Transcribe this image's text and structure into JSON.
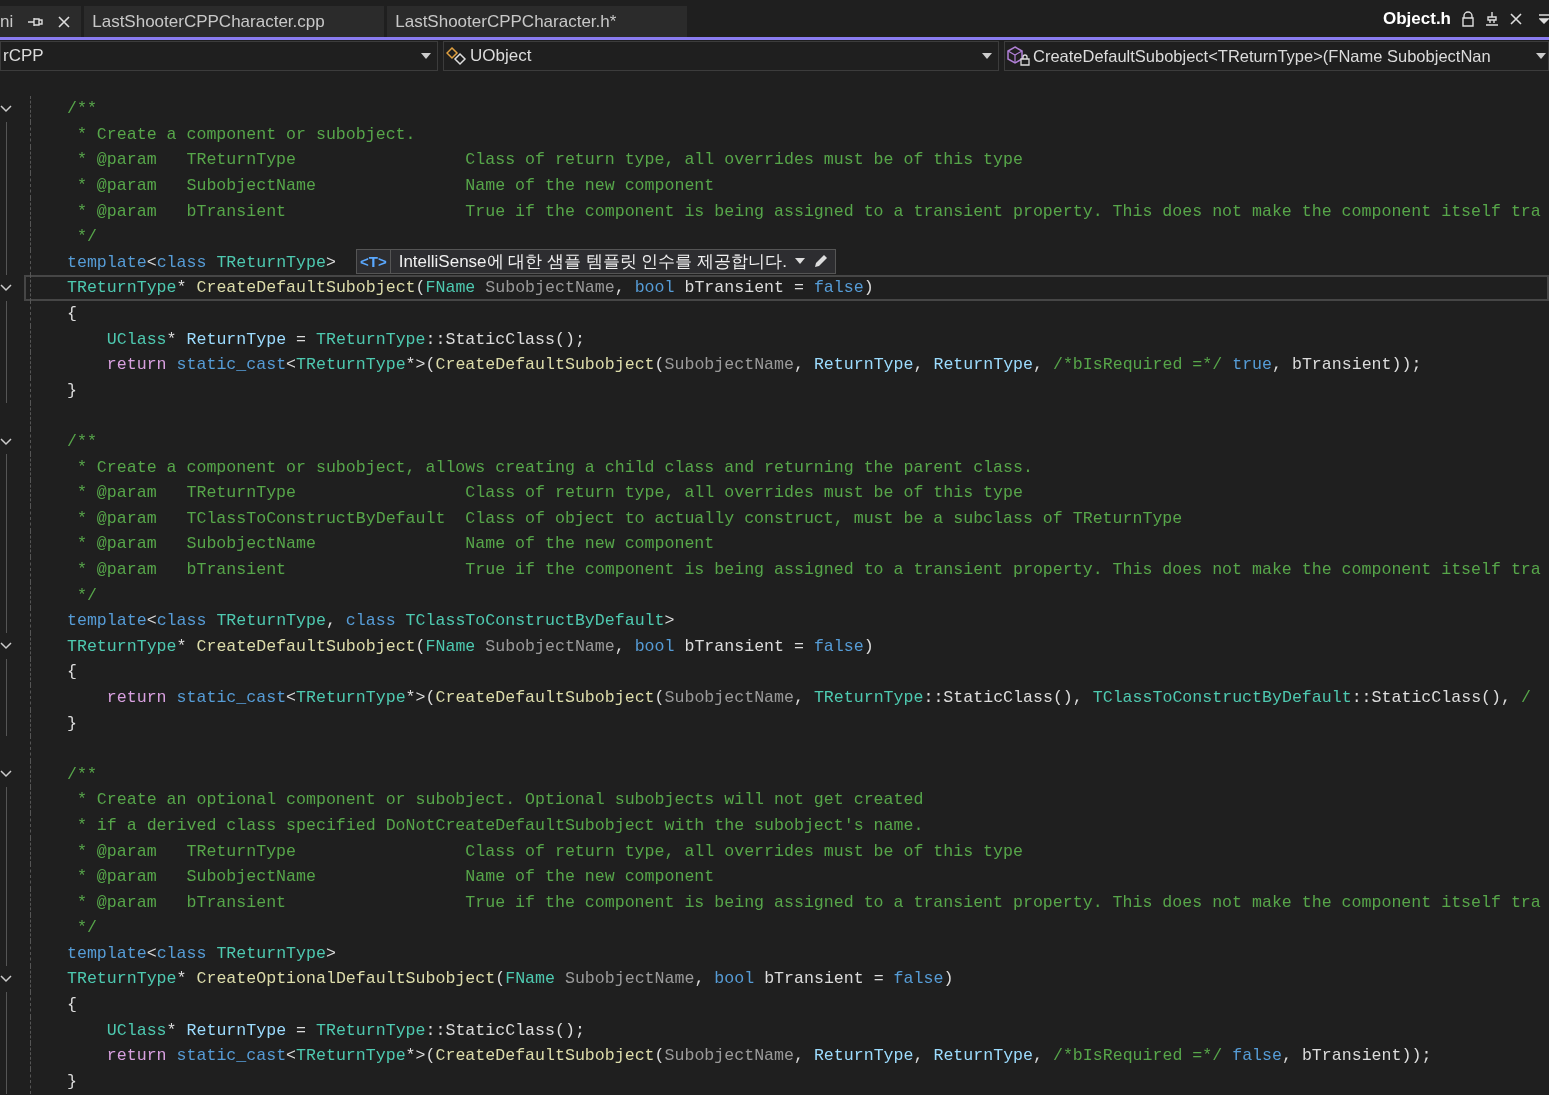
{
  "tabs": [
    {
      "label": "ni",
      "selected": false,
      "pinned": true,
      "closable": true
    },
    {
      "label": "LastShooterCPPCharacter.cpp",
      "selected": false,
      "closable": false
    },
    {
      "label": "LastShooterCPPCharacter.h*",
      "selected": false,
      "closable": false
    }
  ],
  "docked_tabs": [
    {
      "label": "Object.h",
      "selected": true,
      "read_only": true,
      "pinned": false,
      "closable": true
    }
  ],
  "navigation": [
    {
      "label": "rCPP",
      "kind": "plain"
    },
    {
      "label": "UObject",
      "kind": "class"
    },
    {
      "label": "CreateDefaultSubobject<TReturnType>(FName SubobjectNan",
      "kind": "method"
    }
  ],
  "lines": [
    {
      "fold": true,
      "tokens": [
        {
          "kind": "c",
          "text": "/**"
        }
      ]
    },
    {
      "tokens": [
        {
          "kind": "c",
          "text": " * Create a component or subobject."
        }
      ]
    },
    {
      "tokens": [
        {
          "kind": "c",
          "text": " * @param   TReturnType                 Class of return type, all overrides must be of this type"
        }
      ]
    },
    {
      "tokens": [
        {
          "kind": "c",
          "text": " * @param   SubobjectName               Name of the new component"
        }
      ]
    },
    {
      "tokens": [
        {
          "kind": "c",
          "text": " * @param   bTransient                  True if the component is being assigned to a transient property. This does not make the component itself tra"
        }
      ]
    },
    {
      "tokens": [
        {
          "kind": "c",
          "text": " */"
        }
      ]
    },
    {
      "tokens": [
        {
          "kind": "kw",
          "text": "template"
        },
        {
          "kind": "p",
          "text": "<"
        },
        {
          "kind": "kw",
          "text": "class"
        },
        {
          "kind": "ty",
          "text": " TReturnType"
        },
        {
          "kind": "p",
          "text": ">"
        }
      ],
      "hint": {
        "tag": "<T>",
        "text": "IntelliSense에 대한 샘플 템플릿 인수를 제공합니다."
      }
    },
    {
      "fold": true,
      "current": true,
      "tokens": [
        {
          "kind": "ty",
          "text": "TReturnType"
        },
        {
          "kind": "p",
          "text": "*"
        },
        {
          "kind": "fn",
          "text": " CreateDefaultSubobject"
        },
        {
          "kind": "p",
          "text": "("
        },
        {
          "kind": "ty",
          "text": "FName"
        },
        {
          "kind": "prm",
          "text": " SubobjectName"
        },
        {
          "kind": "p",
          "text": ","
        },
        {
          "kind": "kw",
          "text": " bool"
        },
        {
          "kind": "p",
          "text": " bTransient ="
        },
        {
          "kind": "kw",
          "text": " false"
        },
        {
          "kind": "p",
          "text": ")"
        }
      ]
    },
    {
      "tokens": [
        {
          "kind": "p",
          "text": "{"
        }
      ]
    },
    {
      "tokens": [
        {
          "kind": "ty",
          "text": "    UClass"
        },
        {
          "kind": "p",
          "text": "*"
        },
        {
          "kind": "loc",
          "text": " ReturnType"
        },
        {
          "kind": "p",
          "text": " ="
        },
        {
          "kind": "ty",
          "text": " TReturnType"
        },
        {
          "kind": "p",
          "text": "::StaticClass();"
        }
      ]
    },
    {
      "tokens": [
        {
          "kind": "ctl",
          "text": "    return"
        },
        {
          "kind": "kw",
          "text": " static_cast"
        },
        {
          "kind": "p",
          "text": "<"
        },
        {
          "kind": "ty",
          "text": "TReturnType"
        },
        {
          "kind": "p",
          "text": "*>("
        },
        {
          "kind": "fn",
          "text": "CreateDefaultSubobject"
        },
        {
          "kind": "p",
          "text": "("
        },
        {
          "kind": "prm",
          "text": "SubobjectName"
        },
        {
          "kind": "p",
          "text": ","
        },
        {
          "kind": "loc",
          "text": " ReturnType"
        },
        {
          "kind": "p",
          "text": ","
        },
        {
          "kind": "loc",
          "text": " ReturnType"
        },
        {
          "kind": "p",
          "text": ","
        },
        {
          "kind": "c",
          "text": " /*bIsRequired =*/"
        },
        {
          "kind": "kw",
          "text": " true"
        },
        {
          "kind": "p",
          "text": ", bTransient));"
        }
      ]
    },
    {
      "tokens": [
        {
          "kind": "p",
          "text": "}"
        }
      ]
    },
    {
      "blank": true
    },
    {
      "fold": true,
      "tokens": [
        {
          "kind": "c",
          "text": "/**"
        }
      ]
    },
    {
      "tokens": [
        {
          "kind": "c",
          "text": " * Create a component or subobject, allows creating a child class and returning the parent class."
        }
      ]
    },
    {
      "tokens": [
        {
          "kind": "c",
          "text": " * @param   TReturnType                 Class of return type, all overrides must be of this type"
        }
      ]
    },
    {
      "tokens": [
        {
          "kind": "c",
          "text": " * @param   TClassToConstructByDefault  Class of object to actually construct, must be a subclass of TReturnType"
        }
      ]
    },
    {
      "tokens": [
        {
          "kind": "c",
          "text": " * @param   SubobjectName               Name of the new component"
        }
      ]
    },
    {
      "tokens": [
        {
          "kind": "c",
          "text": " * @param   bTransient                  True if the component is being assigned to a transient property. This does not make the component itself tra"
        }
      ]
    },
    {
      "tokens": [
        {
          "kind": "c",
          "text": " */"
        }
      ]
    },
    {
      "tokens": [
        {
          "kind": "kw",
          "text": "template"
        },
        {
          "kind": "p",
          "text": "<"
        },
        {
          "kind": "kw",
          "text": "class"
        },
        {
          "kind": "ty",
          "text": " TReturnType"
        },
        {
          "kind": "p",
          "text": ","
        },
        {
          "kind": "kw",
          "text": " class"
        },
        {
          "kind": "ty",
          "text": " TClassToConstructByDefault"
        },
        {
          "kind": "p",
          "text": ">"
        }
      ]
    },
    {
      "fold": true,
      "tokens": [
        {
          "kind": "ty",
          "text": "TReturnType"
        },
        {
          "kind": "p",
          "text": "*"
        },
        {
          "kind": "fn",
          "text": " CreateDefaultSubobject"
        },
        {
          "kind": "p",
          "text": "("
        },
        {
          "kind": "ty",
          "text": "FName"
        },
        {
          "kind": "prm",
          "text": " SubobjectName"
        },
        {
          "kind": "p",
          "text": ","
        },
        {
          "kind": "kw",
          "text": " bool"
        },
        {
          "kind": "p",
          "text": " bTransient ="
        },
        {
          "kind": "kw",
          "text": " false"
        },
        {
          "kind": "p",
          "text": ")"
        }
      ]
    },
    {
      "tokens": [
        {
          "kind": "p",
          "text": "{"
        }
      ]
    },
    {
      "tokens": [
        {
          "kind": "ctl",
          "text": "    return"
        },
        {
          "kind": "kw",
          "text": " static_cast"
        },
        {
          "kind": "p",
          "text": "<"
        },
        {
          "kind": "ty",
          "text": "TReturnType"
        },
        {
          "kind": "p",
          "text": "*>("
        },
        {
          "kind": "fn",
          "text": "CreateDefaultSubobject"
        },
        {
          "kind": "p",
          "text": "("
        },
        {
          "kind": "prm",
          "text": "SubobjectName"
        },
        {
          "kind": "p",
          "text": ","
        },
        {
          "kind": "ty",
          "text": " TReturnType"
        },
        {
          "kind": "p",
          "text": "::StaticClass(),"
        },
        {
          "kind": "ty",
          "text": " TClassToConstructByDefault"
        },
        {
          "kind": "p",
          "text": "::StaticClass(),"
        },
        {
          "kind": "c",
          "text": " /"
        }
      ]
    },
    {
      "tokens": [
        {
          "kind": "p",
          "text": "}"
        }
      ]
    },
    {
      "blank": true
    },
    {
      "fold": true,
      "tokens": [
        {
          "kind": "c",
          "text": "/**"
        }
      ]
    },
    {
      "tokens": [
        {
          "kind": "c",
          "text": " * Create an optional component or subobject. Optional subobjects will not get created"
        }
      ]
    },
    {
      "tokens": [
        {
          "kind": "c",
          "text": " * if a derived class specified DoNotCreateDefaultSubobject with the subobject's name."
        }
      ]
    },
    {
      "tokens": [
        {
          "kind": "c",
          "text": " * @param   TReturnType                 Class of return type, all overrides must be of this type"
        }
      ]
    },
    {
      "tokens": [
        {
          "kind": "c",
          "text": " * @param   SubobjectName               Name of the new component"
        }
      ]
    },
    {
      "tokens": [
        {
          "kind": "c",
          "text": " * @param   bTransient                  True if the component is being assigned to a transient property. This does not make the component itself tra"
        }
      ]
    },
    {
      "tokens": [
        {
          "kind": "c",
          "text": " */"
        }
      ]
    },
    {
      "tokens": [
        {
          "kind": "kw",
          "text": "template"
        },
        {
          "kind": "p",
          "text": "<"
        },
        {
          "kind": "kw",
          "text": "class"
        },
        {
          "kind": "ty",
          "text": " TReturnType"
        },
        {
          "kind": "p",
          "text": ">"
        }
      ]
    },
    {
      "fold": true,
      "tokens": [
        {
          "kind": "ty",
          "text": "TReturnType"
        },
        {
          "kind": "p",
          "text": "*"
        },
        {
          "kind": "fn",
          "text": " CreateOptionalDefaultSubobject"
        },
        {
          "kind": "p",
          "text": "("
        },
        {
          "kind": "ty",
          "text": "FName"
        },
        {
          "kind": "prm",
          "text": " SubobjectName"
        },
        {
          "kind": "p",
          "text": ","
        },
        {
          "kind": "kw",
          "text": " bool"
        },
        {
          "kind": "p",
          "text": " bTransient ="
        },
        {
          "kind": "kw",
          "text": " false"
        },
        {
          "kind": "p",
          "text": ")"
        }
      ]
    },
    {
      "tokens": [
        {
          "kind": "p",
          "text": "{"
        }
      ]
    },
    {
      "tokens": [
        {
          "kind": "ty",
          "text": "    UClass"
        },
        {
          "kind": "p",
          "text": "*"
        },
        {
          "kind": "loc",
          "text": " ReturnType"
        },
        {
          "kind": "p",
          "text": " ="
        },
        {
          "kind": "ty",
          "text": " TReturnType"
        },
        {
          "kind": "p",
          "text": "::StaticClass();"
        }
      ]
    },
    {
      "tokens": [
        {
          "kind": "ctl",
          "text": "    return"
        },
        {
          "kind": "kw",
          "text": " static_cast"
        },
        {
          "kind": "p",
          "text": "<"
        },
        {
          "kind": "ty",
          "text": "TReturnType"
        },
        {
          "kind": "p",
          "text": "*>("
        },
        {
          "kind": "fn",
          "text": "CreateDefaultSubobject"
        },
        {
          "kind": "p",
          "text": "("
        },
        {
          "kind": "prm",
          "text": "SubobjectName"
        },
        {
          "kind": "p",
          "text": ","
        },
        {
          "kind": "loc",
          "text": " ReturnType"
        },
        {
          "kind": "p",
          "text": ","
        },
        {
          "kind": "loc",
          "text": " ReturnType"
        },
        {
          "kind": "p",
          "text": ","
        },
        {
          "kind": "c",
          "text": " /*bIsRequired =*/"
        },
        {
          "kind": "kw",
          "text": " false"
        },
        {
          "kind": "p",
          "text": ", bTransient));"
        }
      ]
    },
    {
      "tokens": [
        {
          "kind": "p",
          "text": "}"
        }
      ]
    }
  ]
}
